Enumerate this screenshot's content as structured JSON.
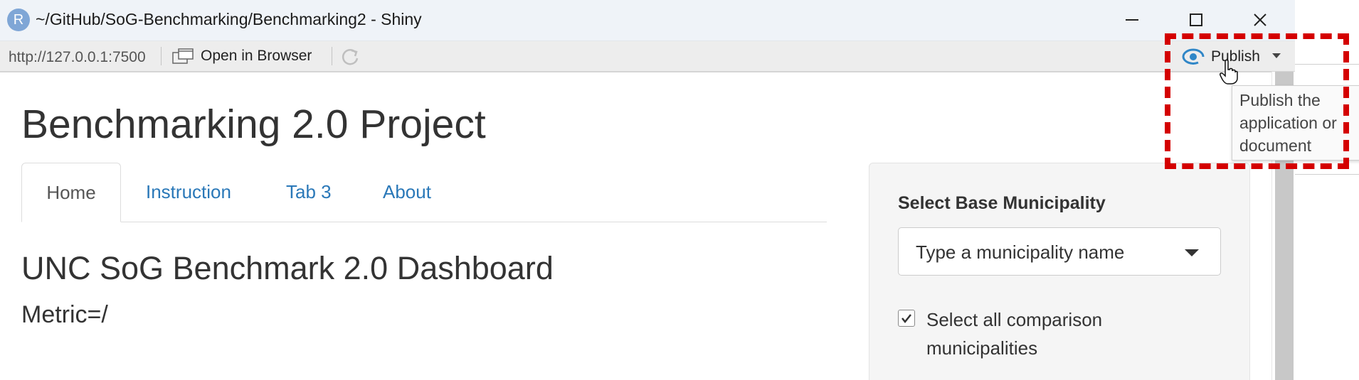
{
  "window": {
    "title": "~/GitHub/SoG-Benchmarking/Benchmarking2 - Shiny",
    "app_icon": "R",
    "controls": [
      "minimize-icon",
      "maximize-icon",
      "close-icon"
    ]
  },
  "toolbar": {
    "url": "http://127.0.0.1:7500",
    "open_in_browser": "Open in Browser",
    "publish": "Publish",
    "publish_tooltip": "Publish the application or document"
  },
  "app": {
    "title": "Benchmarking 2.0 Project",
    "tabs": [
      {
        "label": "Home",
        "active": true
      },
      {
        "label": "Instruction"
      },
      {
        "label": "Tab 3"
      },
      {
        "label": "About"
      }
    ],
    "dashboard_title": "UNC SoG Benchmark 2.0 Dashboard",
    "metric": "Metric=/"
  },
  "sidebar": {
    "select_label": "Select Base Municipality",
    "select_placeholder": "Type a municipality name",
    "checkbox_label": "Select all comparison municipalities",
    "checkbox_checked": true
  },
  "colors": {
    "link": "#2a78b8",
    "annotation": "#d40000",
    "titlebar": "#eff3f8",
    "publish_icon": "#2f86c7"
  }
}
